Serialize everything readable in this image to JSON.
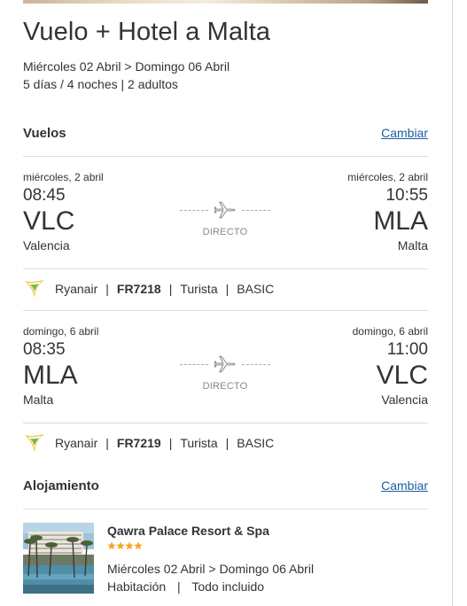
{
  "trip": {
    "title": "Vuelo + Hotel a Malta",
    "dates": "Miércoles 02 Abril > Domingo 06 Abril",
    "summary": "5 días / 4 noches | 2 adultos"
  },
  "flights": {
    "section_title": "Vuelos",
    "change_label": "Cambiar",
    "direct_label": "DIRECTO",
    "legs": [
      {
        "dep_date": "miércoles, 2 abril",
        "dep_time": "08:45",
        "dep_code": "VLC",
        "dep_city": "Valencia",
        "arr_date": "miércoles, 2 abril",
        "arr_time": "10:55",
        "arr_code": "MLA",
        "arr_city": "Malta",
        "airline": "Ryanair",
        "flight_no": "FR7218",
        "cabin": "Turista",
        "fare": "BASIC"
      },
      {
        "dep_date": "domingo, 6 abril",
        "dep_time": "08:35",
        "dep_code": "MLA",
        "dep_city": "Malta",
        "arr_date": "domingo, 6 abril",
        "arr_time": "11:00",
        "arr_code": "VLC",
        "arr_city": "Valencia",
        "airline": "Ryanair",
        "flight_no": "FR7219",
        "cabin": "Turista",
        "fare": "BASIC"
      }
    ]
  },
  "accommodation": {
    "section_title": "Alojamiento",
    "change_label": "Cambiar",
    "hotel_name": "Qawra Palace Resort & Spa",
    "stars": 4,
    "star_color": "#f5a623",
    "dates": "Miércoles 02 Abril  >  Domingo 06 Abril",
    "room": "Habitación",
    "board": "Todo incluido"
  },
  "icons": {
    "plane": "airplane-icon",
    "airline_logo": "ryanair-logo",
    "star": "star-icon"
  },
  "colors": {
    "link": "#1a5fa0",
    "text": "#333333",
    "muted": "#888888",
    "divider": "#dddddd"
  }
}
